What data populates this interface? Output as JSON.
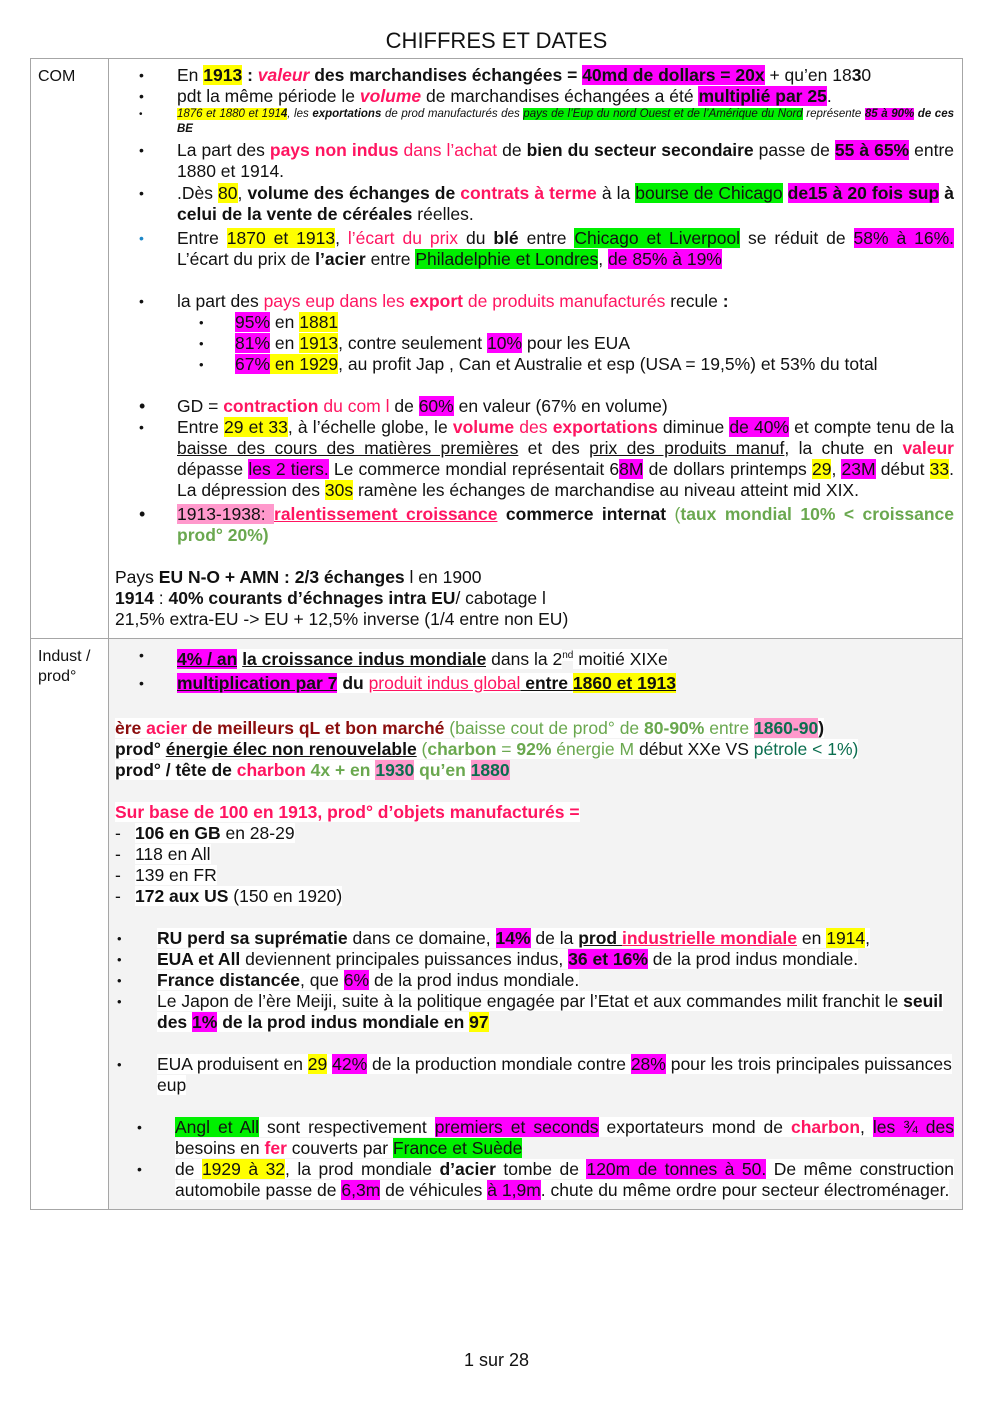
{
  "document": {
    "title": "CHIFFRES ET DATES",
    "page_indicator": "1 sur 28"
  },
  "com": {
    "label": "COM",
    "l1": [
      "En ",
      "1913",
      " : ",
      "valeur",
      " des marchandises échangées = ",
      "40md de dollars = 20x",
      " + qu’en 18",
      "3",
      "0"
    ],
    "l2": [
      " pdt la même période le ",
      "volume",
      " de marchandises échangées a été ",
      "multiplié par 25",
      "."
    ],
    "l3": [
      "1876 et 1880 et 191",
      "4",
      ", les ",
      "exportations",
      " de prod manufacturés des ",
      "pays de l’Eup du nord Ouest et de l’Amérique du Nord",
      " représente ",
      "85 à 90%",
      " de ces BE"
    ],
    "l4": [
      "La part des ",
      "pays non indus",
      " dans l’achat",
      " de ",
      "bien du secteur secondaire",
      " passe de ",
      "55 à 65%",
      " entre 1880 et 1914."
    ],
    "l5": [
      ".Dès ",
      "80",
      ", ",
      "volume des échanges de ",
      "contrats à terme",
      " à la ",
      "bourse de Chicago",
      " ",
      "de15 à 20 fois sup",
      " à celui de la vente de céréales",
      " réelles."
    ],
    "l6": [
      "Entre ",
      "1870 et 1913",
      ", ",
      "l’écart du prix",
      " du ",
      "blé",
      " entre ",
      "Chicago et Liverpool",
      " se réduit de ",
      "58% à 16%.",
      " L’écart du prix de ",
      "l’acier",
      " entre ",
      "Philadelphie et Londres",
      ", ",
      "de 85% à 19%"
    ],
    "l7": [
      "la part des ",
      "pays eup dans les ",
      "export",
      " de produits manufacturés",
      " recule ",
      ":"
    ],
    "l7_sub": [
      [
        "95%",
        " en ",
        "1881",
        ""
      ],
      [
        "81%",
        " en ",
        "1913",
        ", contre seulement ",
        "10%",
        " pour les EUA"
      ],
      [
        "67%",
        " en 1929",
        ", au profit Jap , Can et Australie et esp (USA = 19,5%) et 53% du total"
      ]
    ],
    "l8": [
      "GD = ",
      "contraction",
      " du com l",
      " de ",
      "60%",
      " en valeur (67% en volume)"
    ],
    "l9": [
      "Entre ",
      "29 et 33",
      ", à l’échelle globe, le ",
      "volume",
      " des ",
      "exportations",
      " diminue ",
      "de 40%",
      " et compte tenu de la ",
      "baisse des cours des matières premières",
      " et des ",
      "prix des produits manuf",
      ", la chute en ",
      "valeur",
      " dépasse ",
      "les 2 tiers.",
      " Le commerce mondial représentait 6",
      "8M",
      " de dollars printemps ",
      "29",
      ", ",
      "23M",
      " début ",
      "33",
      ". La dépression des ",
      "30s",
      " ramène les échanges de marchandise au niveau atteint mid XIX."
    ],
    "l10": [
      "1913-1938:  ",
      "ralentissement croissance",
      " commerce internat",
      " (",
      "taux mondial 10% < croissance prod° 20%)"
    ],
    "p1": [
      "Pays ",
      "EU N-O + AMN : 2/3 échanges",
      " l en 1900"
    ],
    "p2": [
      "1914",
      " : ",
      "40% courants d’échnages intra EU",
      "/ cabotage l"
    ],
    "p3": "21,5% extra-EU -> EU + 12,5% inverse (1/4 entre non EU)"
  },
  "indust": {
    "label": "Indust / prod°",
    "b1": [
      "4% / an",
      " ",
      "la croissance indus mondiale",
      " dans la 2",
      "nd",
      " moitié XIXe"
    ],
    "b2": [
      "multiplication par 7",
      " du ",
      "produit indus global",
      " entre ",
      "1860 et 1913"
    ],
    "e1": [
      "ère ",
      "acier",
      " de meilleurs qL et bon marché",
      " (baisse cout de prod° de ",
      "80-90%",
      " entre ",
      "1860-90",
      ")"
    ],
    "e2": [
      "prod° ",
      "énergie élec non renouvelable",
      " (",
      "charbon",
      " = ",
      "92%",
      " énergie M",
      " début XXe VS ",
      "pétrole < 1%)"
    ],
    "e3": [
      "prod° / tête de ",
      "charbon",
      " 4x + en ",
      "1930",
      " qu’en ",
      "1880"
    ],
    "base_title": "Sur base de 100 en 1913, prod° d’objets manufacturés = ",
    "base_items": [
      [
        "106 en GB",
        " en 28-29"
      ],
      [
        "",
        "118 en All"
      ],
      [
        "",
        "139 en FR"
      ],
      [
        "172 aux US",
        " (150 en 1920)"
      ]
    ],
    "r1": [
      "RU perd sa suprématie",
      " dans ce domaine, ",
      "14%",
      " de la ",
      "prod ",
      "industrielle mondiale",
      " en ",
      "1914",
      ","
    ],
    "r2": [
      "EUA et All",
      " deviennent principales puissances indus, ",
      "36 et 16%",
      " de la prod indus mondiale."
    ],
    "r3": [
      "France distancée",
      ", que ",
      "6%",
      " de la prod indus mondiale."
    ],
    "r4": [
      "Le Japon de l’ère Meiji, suite à la politique engagée par l’Etat et aux commandes milit franchit le ",
      "seuil des ",
      "1%",
      " de la prod indus mondiale en ",
      "97"
    ],
    "r5": [
      "EUA produisent en ",
      "29",
      " ",
      "42%",
      " de la production mondiale contre ",
      "28%",
      " pour les trois principales puissances eup"
    ],
    "r6": [
      "Angl et All",
      " sont respectivement ",
      "premiers et seconds",
      " exportateurs mond de ",
      "charbon",
      ", ",
      "les ¾ des",
      " besoins en ",
      "fer",
      " couverts par ",
      "France et Suède"
    ],
    "r7": [
      "de ",
      "1929 à 32",
      ", la prod mondiale ",
      "d’acier",
      " tombe de ",
      "120m de tonnes à 50.",
      " De même construction automobile passe de ",
      "6,3m",
      " de véhicules ",
      "à 1,9m",
      ". chute du même ordre pour secteur électroménager. "
    ]
  }
}
